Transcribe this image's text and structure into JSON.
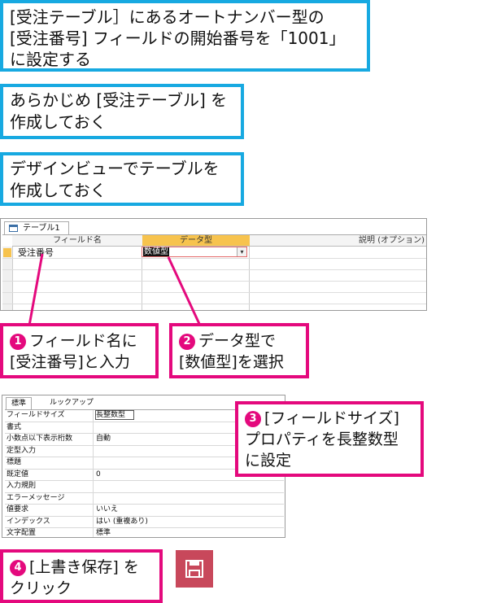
{
  "heading": {
    "line1": "[受注テーブル］にあるオートナンバー型の",
    "line2": "[受注番号] フィールドの開始番号を「1001」",
    "line3": "に設定する"
  },
  "steps_pre": [
    {
      "line1": "あらかじめ [受注テーブル] を",
      "line2": "作成しておく"
    },
    {
      "line1": "デザインビューでテーブルを",
      "line2": "作成しておく"
    }
  ],
  "table_window": {
    "tab_label": "テーブル1",
    "columns": [
      "フィールド名",
      "データ型",
      "説明 (オプション)"
    ],
    "row": {
      "field_name": "受注番号",
      "data_type": "数値型"
    }
  },
  "callouts": [
    {
      "num": "1",
      "line1": "フィールド名に",
      "line2": "[受注番号]と入力"
    },
    {
      "num": "2",
      "line1": "データ型で",
      "line2": "[数値型]を選択"
    },
    {
      "num": "3",
      "line1": "[フィールドサイズ]",
      "line2": "プロパティを長整数型",
      "line3": "に設定"
    },
    {
      "num": "4",
      "line1": "[上書き保存] を",
      "line2": "クリック"
    }
  ],
  "property_sheet": {
    "tabs": [
      "標準",
      "ルックアップ"
    ],
    "rows": [
      {
        "label": "フィールドサイズ",
        "value": "長整数型"
      },
      {
        "label": "書式",
        "value": ""
      },
      {
        "label": "小数点以下表示桁数",
        "value": "自動"
      },
      {
        "label": "定型入力",
        "value": ""
      },
      {
        "label": "標題",
        "value": ""
      },
      {
        "label": "既定値",
        "value": "0"
      },
      {
        "label": "入力規則",
        "value": ""
      },
      {
        "label": "エラーメッセージ",
        "value": ""
      },
      {
        "label": "値要求",
        "value": "いいえ"
      },
      {
        "label": "インデックス",
        "value": "はい (重複あり)"
      },
      {
        "label": "文字配置",
        "value": "標準"
      }
    ]
  },
  "colors": {
    "blue": "#17a9e1",
    "pink": "#e4097d",
    "save_button": "#c8485b",
    "selection": "#f7c34e"
  },
  "icons": {
    "save": "floppy-disk-icon",
    "table": "table-icon",
    "dropdown": "chevron-down-icon"
  }
}
